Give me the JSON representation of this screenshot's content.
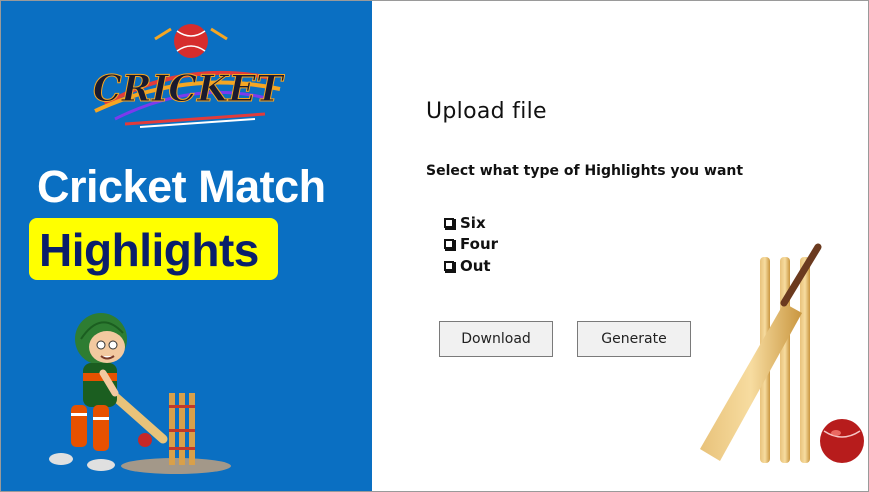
{
  "left_panel": {
    "logo_text": "CRICKET",
    "title_line1": "Cricket Match",
    "title_line2": "Highlights",
    "bg_color": "#0a6fc2",
    "highlight_color": "#ffff00"
  },
  "right_panel": {
    "upload_label": "Upload file",
    "select_label": "Select what type of Highlights you want",
    "options": [
      {
        "label": "Six"
      },
      {
        "label": "Four"
      },
      {
        "label": "Out"
      }
    ],
    "download_label": "Download",
    "generate_label": "Generate"
  }
}
